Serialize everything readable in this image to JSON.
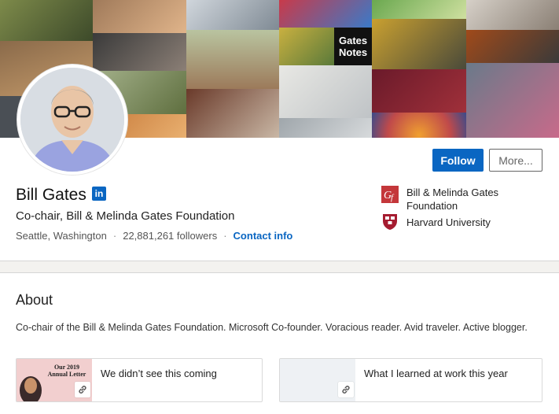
{
  "profile": {
    "name": "Bill Gates",
    "linkedin_badge": "in",
    "headline": "Co-chair, Bill & Melinda Gates Foundation",
    "location": "Seattle, Washington",
    "followers": "22,881,261 followers",
    "separator": "·",
    "contact_info": "Contact info",
    "follow_label": "Follow",
    "more_label": "More...",
    "banner_tile_text": "Gates\nNotes",
    "banner_tile_line1": "Gates",
    "banner_tile_line2": "Notes"
  },
  "organizations": [
    {
      "name": "Bill & Melinda Gates Foundation",
      "logo": "gates-foundation-logo"
    },
    {
      "name": "Harvard University",
      "logo": "harvard-shield-logo"
    }
  ],
  "about": {
    "title": "About",
    "text": "Co-chair of the Bill & Melinda Gates Foundation. Microsoft Co-founder. Voracious reader. Avid traveler. Active blogger.",
    "media": [
      {
        "title": "We didn’t see this coming",
        "thumb_text_1": "Our 2019",
        "thumb_text_2": "Annual Letter",
        "icon": "link-icon"
      },
      {
        "title": "What I learned at work this year",
        "icon": "link-icon"
      }
    ]
  },
  "colors": {
    "accent": "#0a66c2",
    "card": "#ffffff",
    "page": "#f3f2ef"
  }
}
